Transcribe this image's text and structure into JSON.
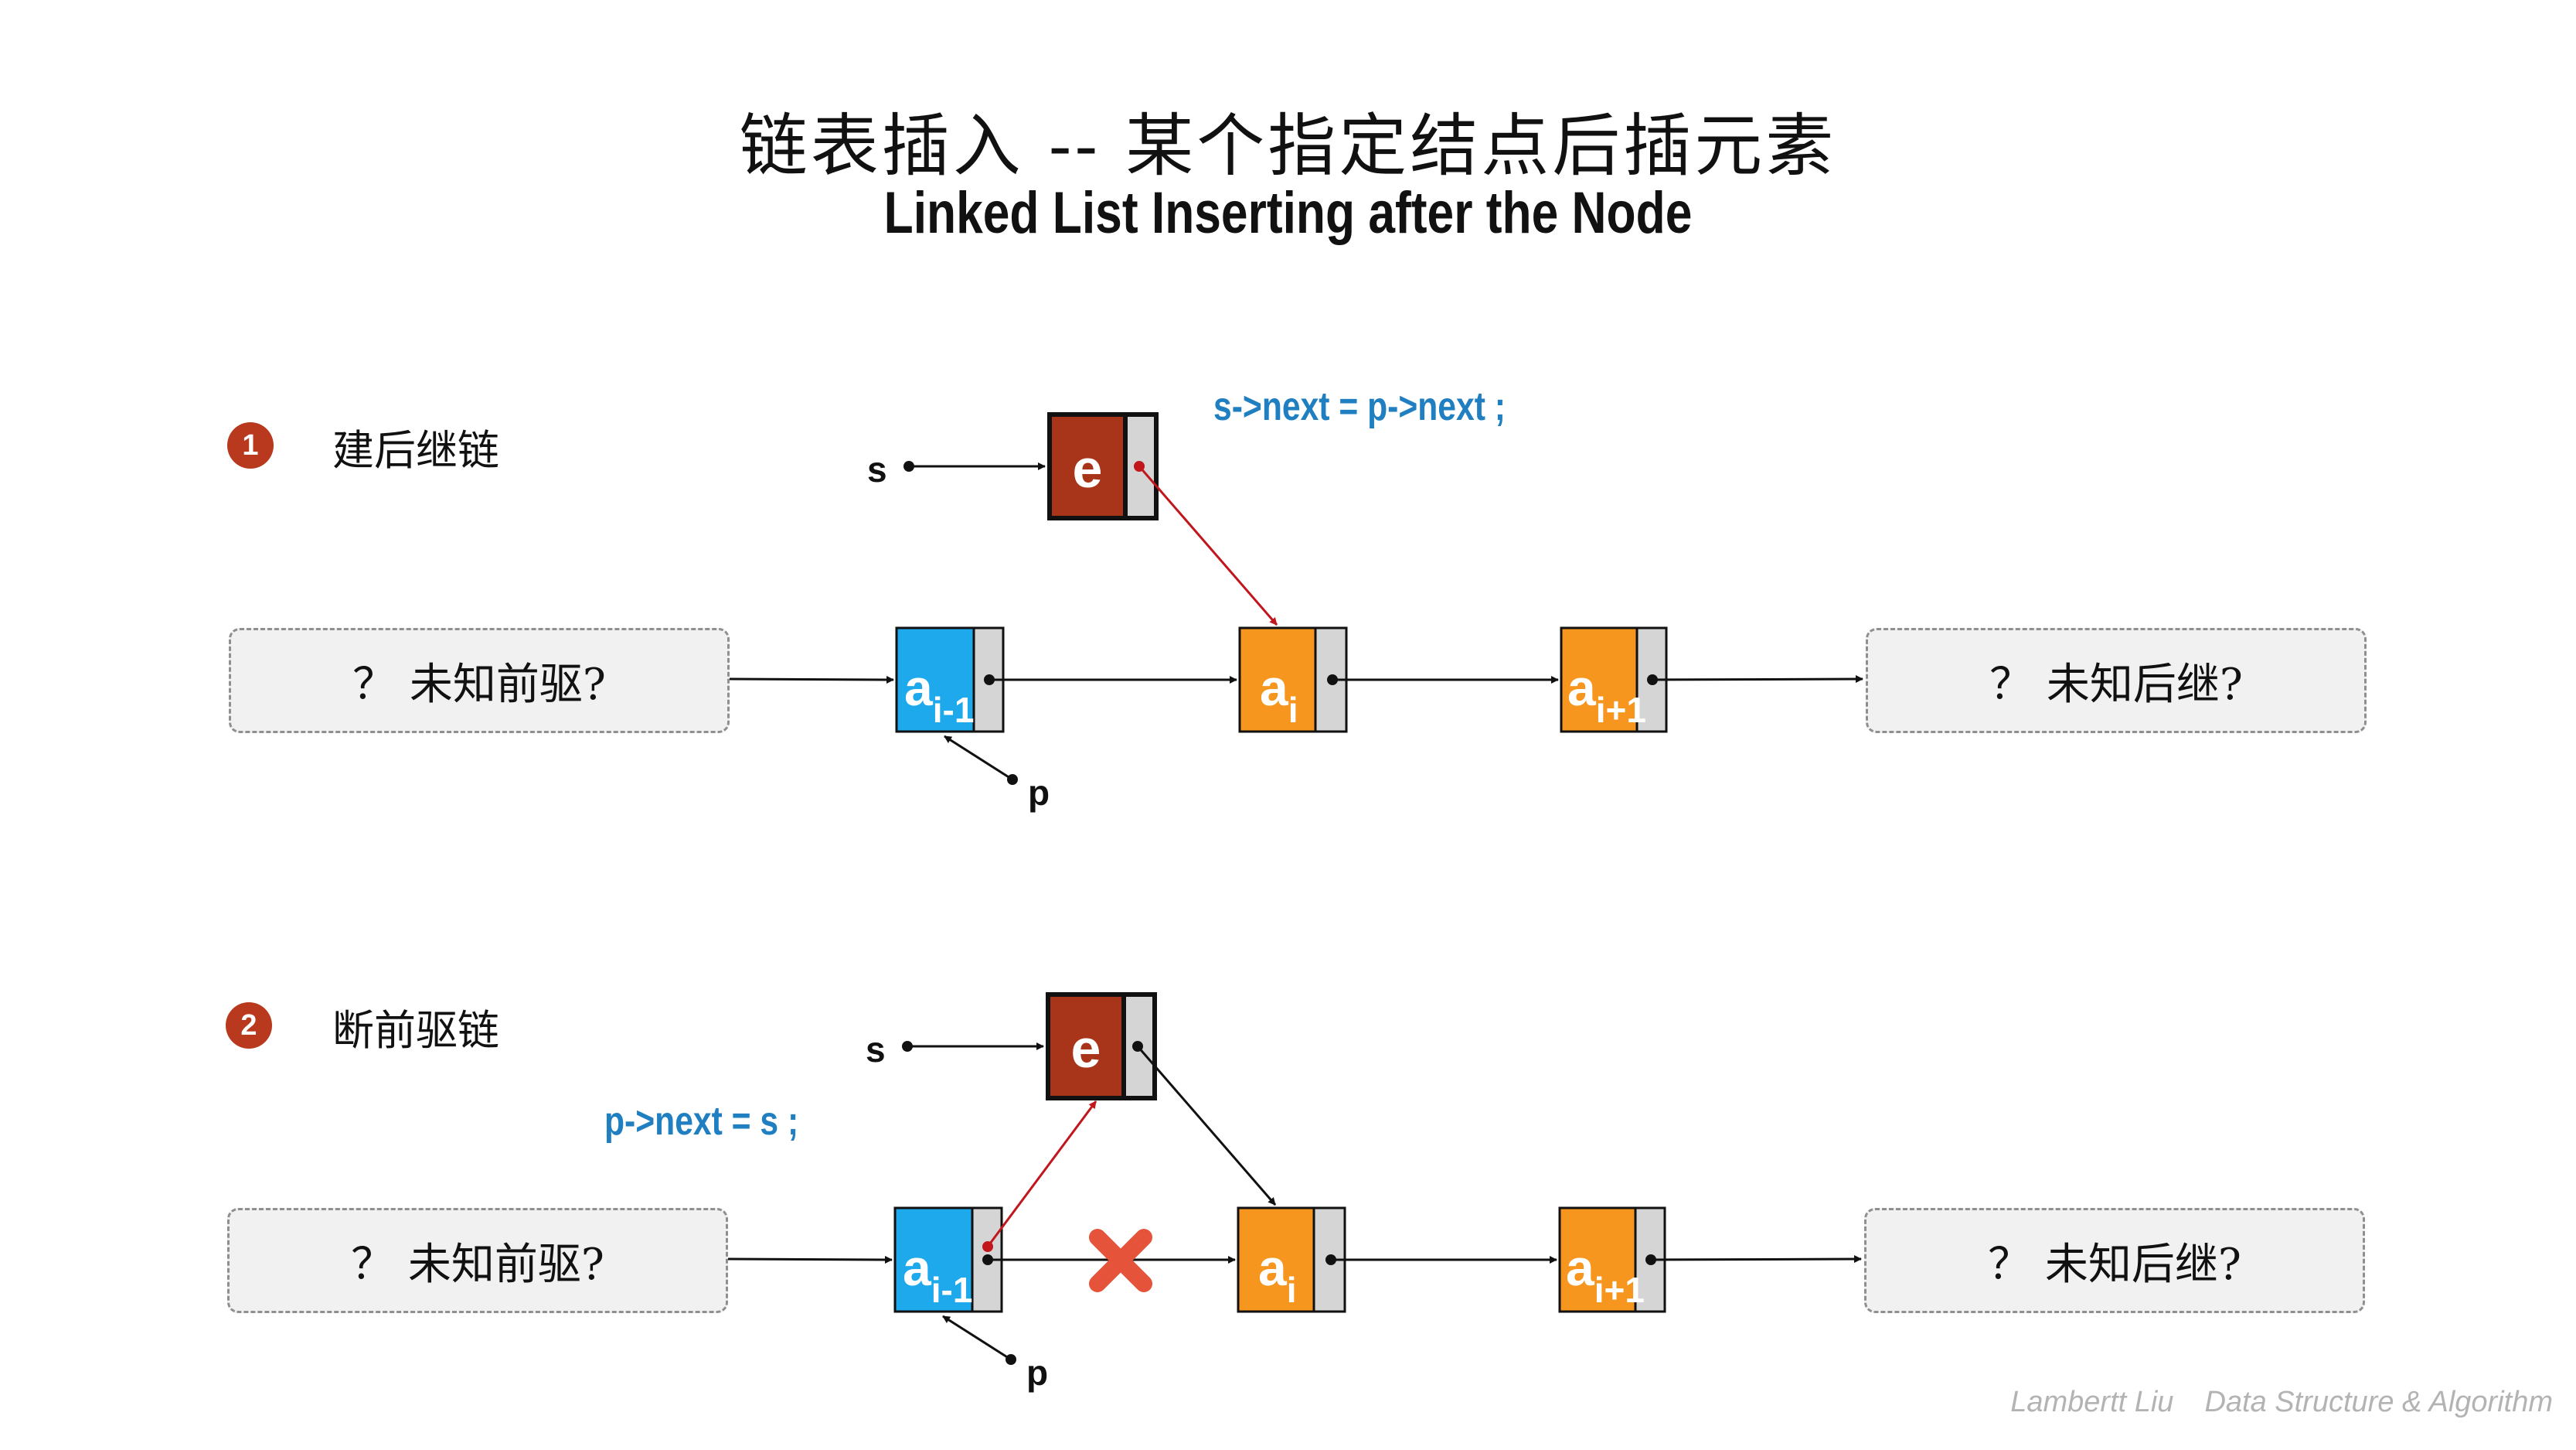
{
  "title": {
    "cn": "链表插入 -- 某个指定结点后插元素",
    "en": "Linked List Inserting after the Node"
  },
  "steps": [
    {
      "number": "1",
      "label": "建后继链",
      "code": "s->next = p->next ;"
    },
    {
      "number": "2",
      "label": "断前驱链",
      "code": "p->next = s ;"
    }
  ],
  "unknown_prev": "？ 未知前驱?",
  "unknown_next": "？ 未知后继?",
  "pointers": {
    "s": "s",
    "p": "p"
  },
  "nodes": {
    "new": "e",
    "prev": {
      "base": "a",
      "sub": "i-1"
    },
    "cur": {
      "base": "a",
      "sub": "i"
    },
    "next": {
      "base": "a",
      "sub": "i+1"
    }
  },
  "footer": {
    "author": "Lambertt Liu",
    "course": "Data Structure & Algorithm"
  },
  "colors": {
    "node_new": "#a8341a",
    "node_prev": "#1ea9ec",
    "node_cur": "#f6961f",
    "node_next": "#f6961f",
    "node_ptr_cell": "#d5d5d5",
    "highlight_arrow": "#c0161c",
    "cross": "#e5533b",
    "code": "#1f7fc1"
  }
}
